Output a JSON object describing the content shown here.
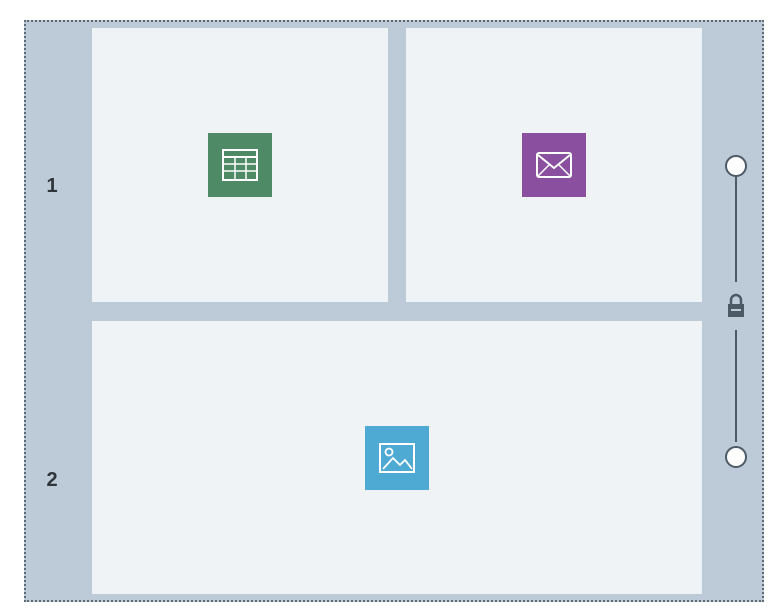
{
  "rows": [
    {
      "label": "1"
    },
    {
      "label": "2"
    }
  ],
  "tiles": [
    {
      "icon": "table-icon",
      "color": "#4f8a66"
    },
    {
      "icon": "envelope-icon",
      "color": "#8a4f9e"
    },
    {
      "icon": "image-icon",
      "color": "#4eaad3"
    }
  ],
  "slider": {
    "lock_icon": "lock-icon",
    "handle_icon": "circle-handle-icon"
  },
  "colors": {
    "frame_background": "#bccbd7",
    "tile_background": "#f0f3f6",
    "slider_line": "#4c5a66"
  }
}
